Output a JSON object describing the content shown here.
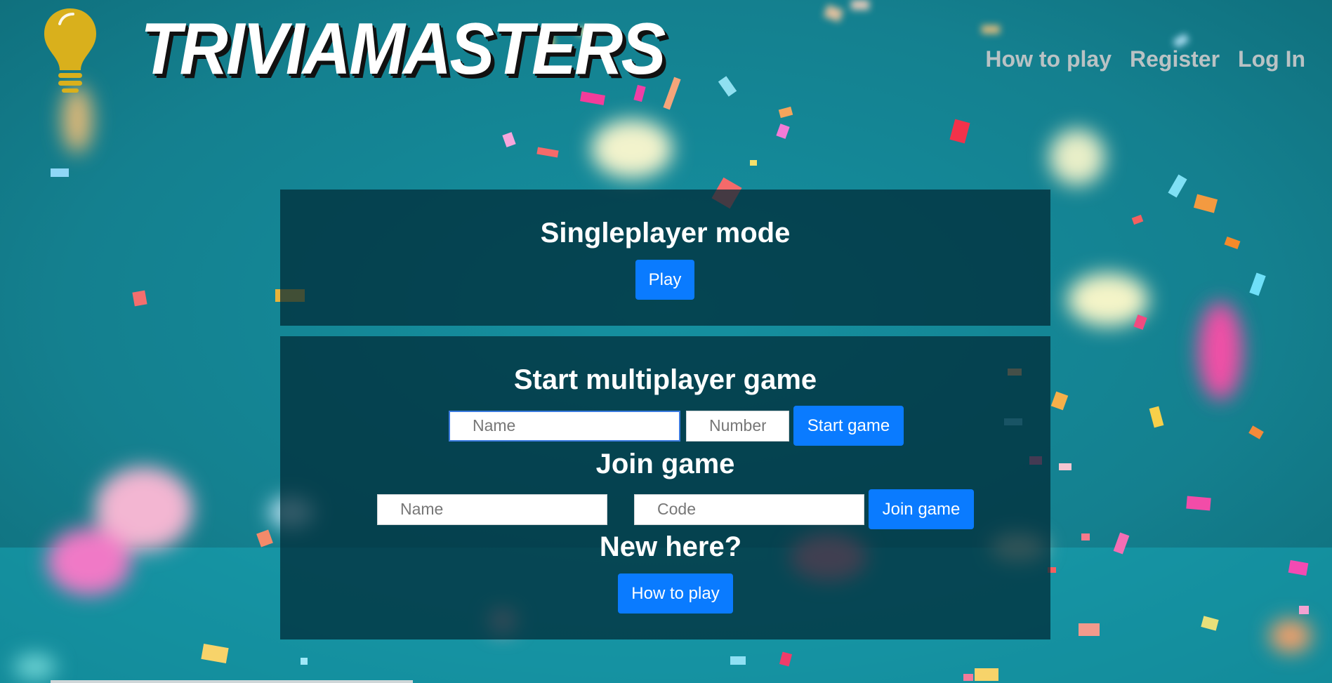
{
  "header": {
    "logo_text": "TRIVIAMASTERS",
    "nav": [
      {
        "label": "How to play"
      },
      {
        "label": "Register"
      },
      {
        "label": "Log In"
      }
    ]
  },
  "singleplayer": {
    "title": "Singleplayer mode",
    "play_label": "Play"
  },
  "multiplayer": {
    "title": "Start multiplayer game",
    "name_placeholder": "Name",
    "number_placeholder": "Number",
    "start_label": "Start game"
  },
  "join": {
    "title": "Join game",
    "name_placeholder": "Name",
    "code_placeholder": "Code",
    "join_label": "Join game"
  },
  "new_here": {
    "title": "New here?",
    "button_label": "How to play"
  },
  "colors": {
    "background": "#1a8d9c",
    "panel": "#00283a",
    "button": "#0a7bff",
    "logo_bulb": "#d9b01c",
    "nav_text": "#b9c2c4"
  },
  "icons": {
    "logo": "lightbulb-icon"
  }
}
